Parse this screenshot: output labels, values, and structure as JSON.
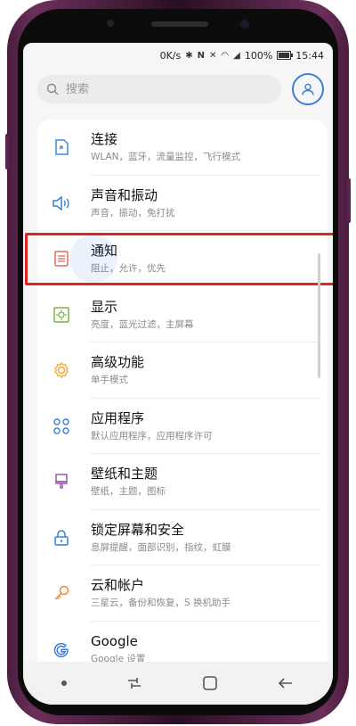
{
  "status_bar": {
    "speed": "0K/s",
    "battery": "100%",
    "time": "15:44"
  },
  "search": {
    "placeholder": "搜索"
  },
  "settings": [
    {
      "title": "连接",
      "subtitle": "WLAN，蓝牙，流量监控，飞行模式",
      "icon": "connection-icon"
    },
    {
      "title": "声音和振动",
      "subtitle": "声音，振动，免打扰",
      "icon": "speaker-icon"
    },
    {
      "title": "通知",
      "subtitle": "阻止，允许，优先",
      "icon": "notification-icon",
      "highlighted": true
    },
    {
      "title": "显示",
      "subtitle": "亮度，蓝光过滤，主屏幕",
      "icon": "display-icon"
    },
    {
      "title": "高级功能",
      "subtitle": "单手模式",
      "icon": "advanced-gear-icon"
    },
    {
      "title": "应用程序",
      "subtitle": "默认应用程序，应用程序许可",
      "icon": "apps-grid-icon"
    },
    {
      "title": "壁纸和主题",
      "subtitle": "壁纸，主题，图标",
      "icon": "paintbrush-icon"
    },
    {
      "title": "锁定屏幕和安全",
      "subtitle": "息屏提醒，面部识别，指纹，虹膜",
      "icon": "lock-icon"
    },
    {
      "title": "云和帐户",
      "subtitle": "三星云，备份和恢复，S 换机助手",
      "icon": "key-icon"
    },
    {
      "title": "Google",
      "subtitle": "Google 设置",
      "icon": "google-icon"
    }
  ],
  "colors": {
    "highlight": "#e02424",
    "accent": "#3d7fd6"
  }
}
